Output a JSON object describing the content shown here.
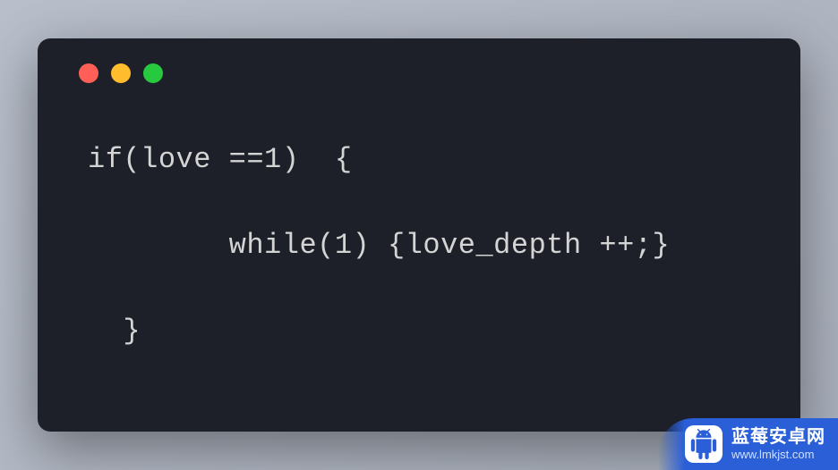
{
  "window": {
    "controls": [
      "close",
      "minimize",
      "maximize"
    ]
  },
  "code": {
    "lines": [
      "if(love ==1)  {",
      "",
      "        while(1) {love_depth ++;}",
      "",
      "  }"
    ]
  },
  "watermark": {
    "title": "蓝莓安卓网",
    "url": "www.lmkjst.com"
  }
}
